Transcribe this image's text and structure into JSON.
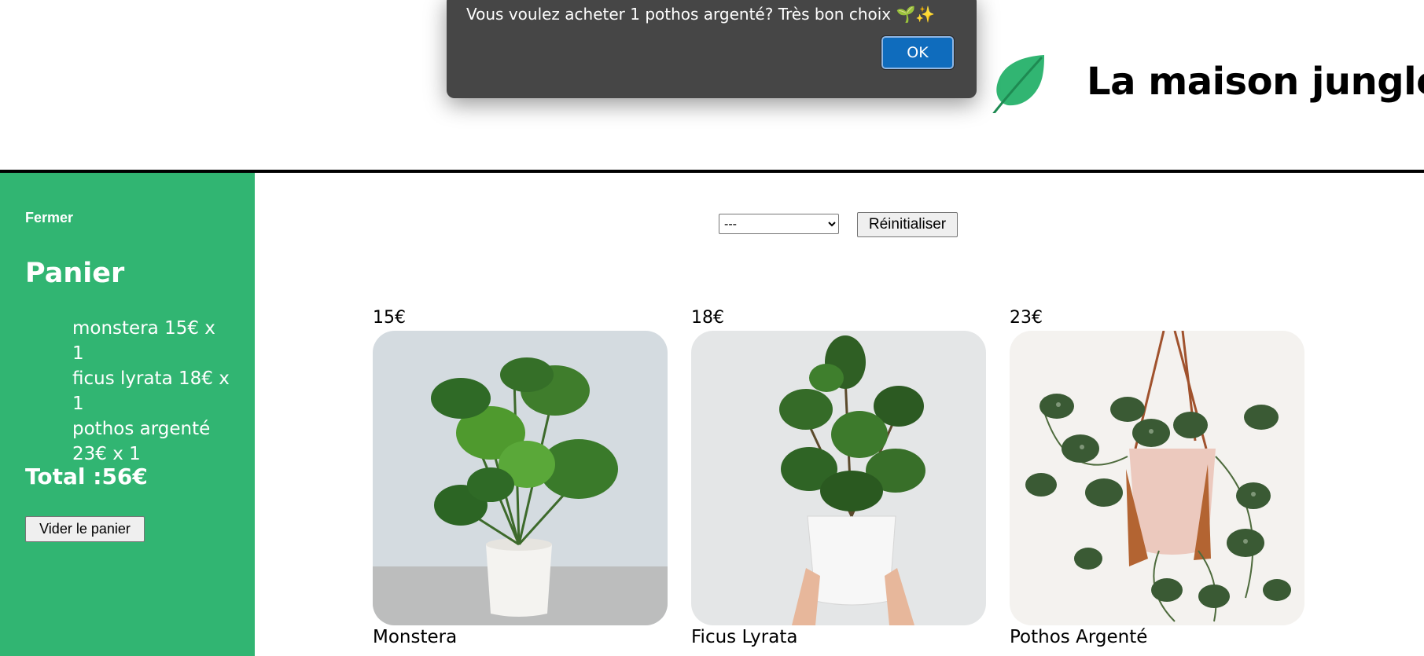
{
  "alert": {
    "message": "Vous voulez acheter 1 pothos argenté? Très bon choix 🌱✨",
    "ok_label": "OK"
  },
  "banner": {
    "title": "La maison jungle",
    "logo_icon": "leaf-icon"
  },
  "cart": {
    "close_label": "Fermer",
    "title": "Panier",
    "items": [
      "monstera 15€ x 1",
      "ficus lyrata 18€ x 1",
      "pothos argenté 23€ x 1"
    ],
    "total": "Total :56€",
    "empty_label": "Vider le panier"
  },
  "filters": {
    "selected": "---",
    "reset_label": "Réinitialiser"
  },
  "plants": [
    {
      "price": "15€",
      "name": "Monstera"
    },
    {
      "price": "18€",
      "name": "Ficus Lyrata"
    },
    {
      "price": "23€",
      "name": "Pothos Argenté"
    }
  ],
  "colors": {
    "sidebar": "#31b572",
    "alert_bg": "#464646",
    "alert_button": "#0f6cbd",
    "leaf": "#31b572"
  }
}
